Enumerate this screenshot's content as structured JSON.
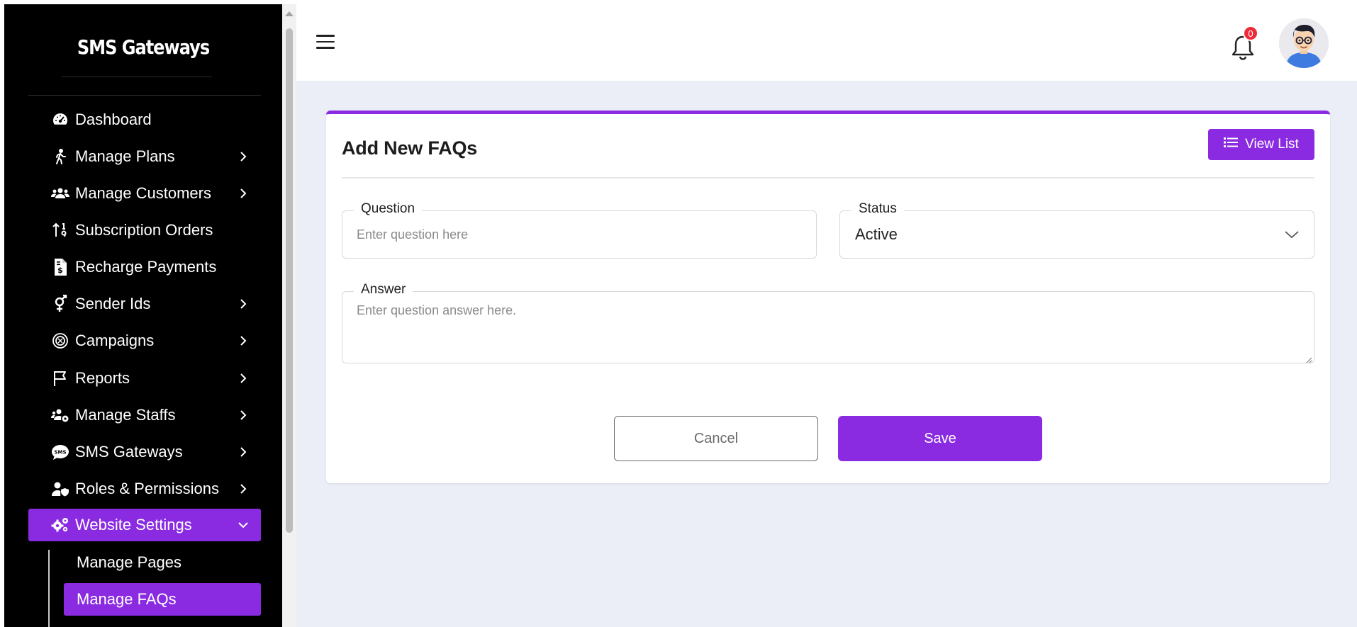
{
  "brand": {
    "title": "SMS Gateways"
  },
  "sidebar": {
    "items": [
      {
        "label": "Dashboard",
        "icon": "speedometer-icon"
      },
      {
        "label": "Manage Plans",
        "icon": "walking-person-icon"
      },
      {
        "label": "Manage Customers",
        "icon": "users-group-icon"
      },
      {
        "label": "Subscription Orders",
        "icon": "sort-numeric-icon"
      },
      {
        "label": "Recharge Payments",
        "icon": "invoice-dollar-icon"
      },
      {
        "label": "Sender Ids",
        "icon": "gender-symbol-icon"
      },
      {
        "label": "Campaigns",
        "icon": "campaign-circle-icon"
      },
      {
        "label": "Reports",
        "icon": "flag-icon"
      },
      {
        "label": "Manage Staffs",
        "icon": "users-cog-icon"
      },
      {
        "label": "SMS Gateways",
        "icon": "sms-bubble-icon"
      },
      {
        "label": "Roles & Permissions",
        "icon": "user-shield-icon"
      },
      {
        "label": "Website Settings",
        "icon": "gears-icon"
      }
    ],
    "submenu": [
      {
        "label": "Manage Pages"
      },
      {
        "label": "Manage FAQs"
      }
    ]
  },
  "header": {
    "notification_count": "0"
  },
  "page": {
    "title": "Add New FAQs",
    "view_list_label": "View List",
    "question": {
      "label": "Question",
      "placeholder": "Enter question here"
    },
    "status": {
      "label": "Status",
      "value": "Active"
    },
    "answer": {
      "label": "Answer",
      "placeholder": "Enter question answer here."
    },
    "cancel_label": "Cancel",
    "save_label": "Save"
  },
  "colors": {
    "accent": "#8a2be2",
    "sidebar_bg": "#000000",
    "main_bg": "#ebeef7",
    "badge": "#ef2b3a"
  }
}
